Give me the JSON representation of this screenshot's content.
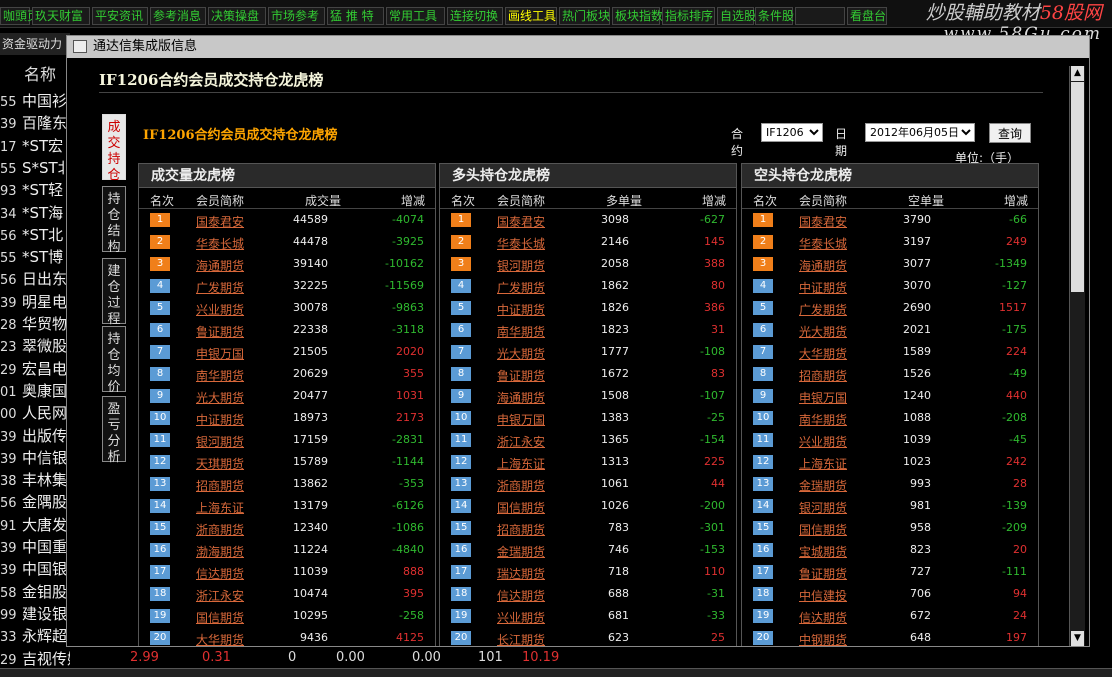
{
  "topbar": {
    "buttons": [
      "咖頭页",
      "玖天财富",
      "平安资讯",
      "参考消息",
      "决策操盘",
      "市场参考",
      "猛 推 特",
      "常用工具",
      "连接切换",
      "画线工具",
      "热门板块",
      "板块指数",
      "指标排序",
      "自选股",
      "条件股",
      "",
      "看盘台"
    ]
  },
  "watermark": {
    "line1_a": "炒股輔助教材",
    "line1_b": "58股网",
    "line2": "www.58Gu.com"
  },
  "left_list": {
    "header": "资金驱动力",
    "column": "名称",
    "rows": [
      {
        "n": "55",
        "name": "中国衫"
      },
      {
        "n": "39",
        "name": "百隆东"
      },
      {
        "n": "17",
        "name": "*ST宏"
      },
      {
        "n": "55",
        "name": "S*ST北"
      },
      {
        "n": "93",
        "name": "*ST轻"
      },
      {
        "n": "34",
        "name": "*ST海"
      },
      {
        "n": "56",
        "name": "*ST北"
      },
      {
        "n": "55",
        "name": "*ST博"
      },
      {
        "n": "56",
        "name": "日出东"
      },
      {
        "n": "39",
        "name": "明星电"
      },
      {
        "n": "28",
        "name": "华贸物"
      },
      {
        "n": "23",
        "name": "翠微股"
      },
      {
        "n": "29",
        "name": "宏昌电"
      },
      {
        "n": "01",
        "name": "奥康国"
      },
      {
        "n": "00",
        "name": "人民网"
      },
      {
        "n": "39",
        "name": "出版传"
      },
      {
        "n": "39",
        "name": "中信银"
      },
      {
        "n": "38",
        "name": "丰林集"
      },
      {
        "n": "56",
        "name": "金隅股"
      },
      {
        "n": "91",
        "name": "大唐发"
      },
      {
        "n": "39",
        "name": "中国重"
      },
      {
        "n": "39",
        "name": "中国银"
      },
      {
        "n": "58",
        "name": "金钼股"
      },
      {
        "n": "99",
        "name": "建设银"
      },
      {
        "n": "33",
        "name": "永辉超"
      },
      {
        "n": "29",
        "name": "吉视传媒"
      }
    ],
    "bottom_values": [
      "2.99",
      "0.31",
      "0",
      "0.00",
      "0.00",
      "101",
      "10.19"
    ]
  },
  "dialog": {
    "title": "通达信集成版信息",
    "header": "IF1206合约会员成交持仓龙虎榜",
    "subtitle": "IF1206合约会员成交持仓龙虎榜",
    "side_tabs": [
      "成交持仓",
      "持仓结构",
      "建仓过程",
      "持仓均价",
      "盈亏分析"
    ],
    "contract_label": "合约",
    "contract_value": "IF1206",
    "date_label": "日期",
    "date_value": "2012年06月05日",
    "query_label": "查询",
    "unit": "单位:（手）",
    "panels": [
      {
        "title": "成交量龙虎榜",
        "headers": [
          "名次",
          "会员简称",
          "成交量",
          "增减"
        ],
        "rows": [
          {
            "rank": "1",
            "name": "国泰君安",
            "value": "44589",
            "change": "-4074"
          },
          {
            "rank": "2",
            "name": "华泰长城",
            "value": "44478",
            "change": "-3925"
          },
          {
            "rank": "3",
            "name": "海通期货",
            "value": "39140",
            "change": "-10162"
          },
          {
            "rank": "4",
            "name": "广发期货",
            "value": "32225",
            "change": "-11569"
          },
          {
            "rank": "5",
            "name": "兴业期货",
            "value": "30078",
            "change": "-9863"
          },
          {
            "rank": "6",
            "name": "鲁证期货",
            "value": "22338",
            "change": "-3118"
          },
          {
            "rank": "7",
            "name": "申银万国",
            "value": "21505",
            "change": "2020"
          },
          {
            "rank": "8",
            "name": "南华期货",
            "value": "20629",
            "change": "355"
          },
          {
            "rank": "9",
            "name": "光大期货",
            "value": "20477",
            "change": "1031"
          },
          {
            "rank": "10",
            "name": "中证期货",
            "value": "18973",
            "change": "2173"
          },
          {
            "rank": "11",
            "name": "银河期货",
            "value": "17159",
            "change": "-2831"
          },
          {
            "rank": "12",
            "name": "天琪期货",
            "value": "15789",
            "change": "-1144"
          },
          {
            "rank": "13",
            "name": "招商期货",
            "value": "13862",
            "change": "-353"
          },
          {
            "rank": "14",
            "name": "上海东证",
            "value": "13179",
            "change": "-6126"
          },
          {
            "rank": "15",
            "name": "浙商期货",
            "value": "12340",
            "change": "-1086"
          },
          {
            "rank": "16",
            "name": "渤海期货",
            "value": "11224",
            "change": "-4840"
          },
          {
            "rank": "17",
            "name": "信达期货",
            "value": "11039",
            "change": "888"
          },
          {
            "rank": "18",
            "name": "浙江永安",
            "value": "10474",
            "change": "395"
          },
          {
            "rank": "19",
            "name": "国信期货",
            "value": "10295",
            "change": "-258"
          },
          {
            "rank": "20",
            "name": "大华期货",
            "value": "9436",
            "change": "4125"
          }
        ]
      },
      {
        "title": "多头持仓龙虎榜",
        "headers": [
          "名次",
          "会员简称",
          "多单量",
          "增减"
        ],
        "rows": [
          {
            "rank": "1",
            "name": "国泰君安",
            "value": "3098",
            "change": "-627"
          },
          {
            "rank": "2",
            "name": "华泰长城",
            "value": "2146",
            "change": "145"
          },
          {
            "rank": "3",
            "name": "银河期货",
            "value": "2058",
            "change": "388"
          },
          {
            "rank": "4",
            "name": "广发期货",
            "value": "1862",
            "change": "80"
          },
          {
            "rank": "5",
            "name": "中证期货",
            "value": "1826",
            "change": "386"
          },
          {
            "rank": "6",
            "name": "南华期货",
            "value": "1823",
            "change": "31"
          },
          {
            "rank": "7",
            "name": "光大期货",
            "value": "1777",
            "change": "-108"
          },
          {
            "rank": "8",
            "name": "鲁证期货",
            "value": "1672",
            "change": "83"
          },
          {
            "rank": "9",
            "name": "海通期货",
            "value": "1508",
            "change": "-107"
          },
          {
            "rank": "10",
            "name": "申银万国",
            "value": "1383",
            "change": "-25"
          },
          {
            "rank": "11",
            "name": "浙江永安",
            "value": "1365",
            "change": "-154"
          },
          {
            "rank": "12",
            "name": "上海东证",
            "value": "1313",
            "change": "225"
          },
          {
            "rank": "13",
            "name": "浙商期货",
            "value": "1061",
            "change": "44"
          },
          {
            "rank": "14",
            "name": "国信期货",
            "value": "1026",
            "change": "-200"
          },
          {
            "rank": "15",
            "name": "招商期货",
            "value": "783",
            "change": "-301"
          },
          {
            "rank": "16",
            "name": "金瑞期货",
            "value": "746",
            "change": "-153"
          },
          {
            "rank": "17",
            "name": "瑞达期货",
            "value": "718",
            "change": "110"
          },
          {
            "rank": "18",
            "name": "信达期货",
            "value": "688",
            "change": "-31"
          },
          {
            "rank": "19",
            "name": "兴业期货",
            "value": "681",
            "change": "-33"
          },
          {
            "rank": "20",
            "name": "长江期货",
            "value": "623",
            "change": "25"
          }
        ]
      },
      {
        "title": "空头持仓龙虎榜",
        "headers": [
          "名次",
          "会员简称",
          "空单量",
          "增减"
        ],
        "rows": [
          {
            "rank": "1",
            "name": "国泰君安",
            "value": "3790",
            "change": "-66"
          },
          {
            "rank": "2",
            "name": "华泰长城",
            "value": "3197",
            "change": "249"
          },
          {
            "rank": "3",
            "name": "海通期货",
            "value": "3077",
            "change": "-1349"
          },
          {
            "rank": "4",
            "name": "中证期货",
            "value": "3070",
            "change": "-127"
          },
          {
            "rank": "5",
            "name": "广发期货",
            "value": "2690",
            "change": "1517"
          },
          {
            "rank": "6",
            "name": "光大期货",
            "value": "2021",
            "change": "-175"
          },
          {
            "rank": "7",
            "name": "大华期货",
            "value": "1589",
            "change": "224"
          },
          {
            "rank": "8",
            "name": "招商期货",
            "value": "1526",
            "change": "-49"
          },
          {
            "rank": "9",
            "name": "申银万国",
            "value": "1240",
            "change": "440"
          },
          {
            "rank": "10",
            "name": "南华期货",
            "value": "1088",
            "change": "-208"
          },
          {
            "rank": "11",
            "name": "兴业期货",
            "value": "1039",
            "change": "-45"
          },
          {
            "rank": "12",
            "name": "上海东证",
            "value": "1023",
            "change": "242"
          },
          {
            "rank": "13",
            "name": "金瑞期货",
            "value": "993",
            "change": "28"
          },
          {
            "rank": "14",
            "name": "银河期货",
            "value": "981",
            "change": "-139"
          },
          {
            "rank": "15",
            "name": "国信期货",
            "value": "958",
            "change": "-209"
          },
          {
            "rank": "16",
            "name": "宝城期货",
            "value": "823",
            "change": "20"
          },
          {
            "rank": "17",
            "name": "鲁证期货",
            "value": "727",
            "change": "-111"
          },
          {
            "rank": "18",
            "name": "中信建投",
            "value": "706",
            "change": "94"
          },
          {
            "rank": "19",
            "name": "信达期货",
            "value": "672",
            "change": "24"
          },
          {
            "rank": "20",
            "name": "中钢期货",
            "value": "648",
            "change": "197"
          }
        ]
      }
    ]
  },
  "colors": {
    "up": "#e03030",
    "down": "#2fb92f",
    "rank_top": "#f07f1a",
    "rank": "#5b9bd5",
    "member": "#d8683a"
  }
}
